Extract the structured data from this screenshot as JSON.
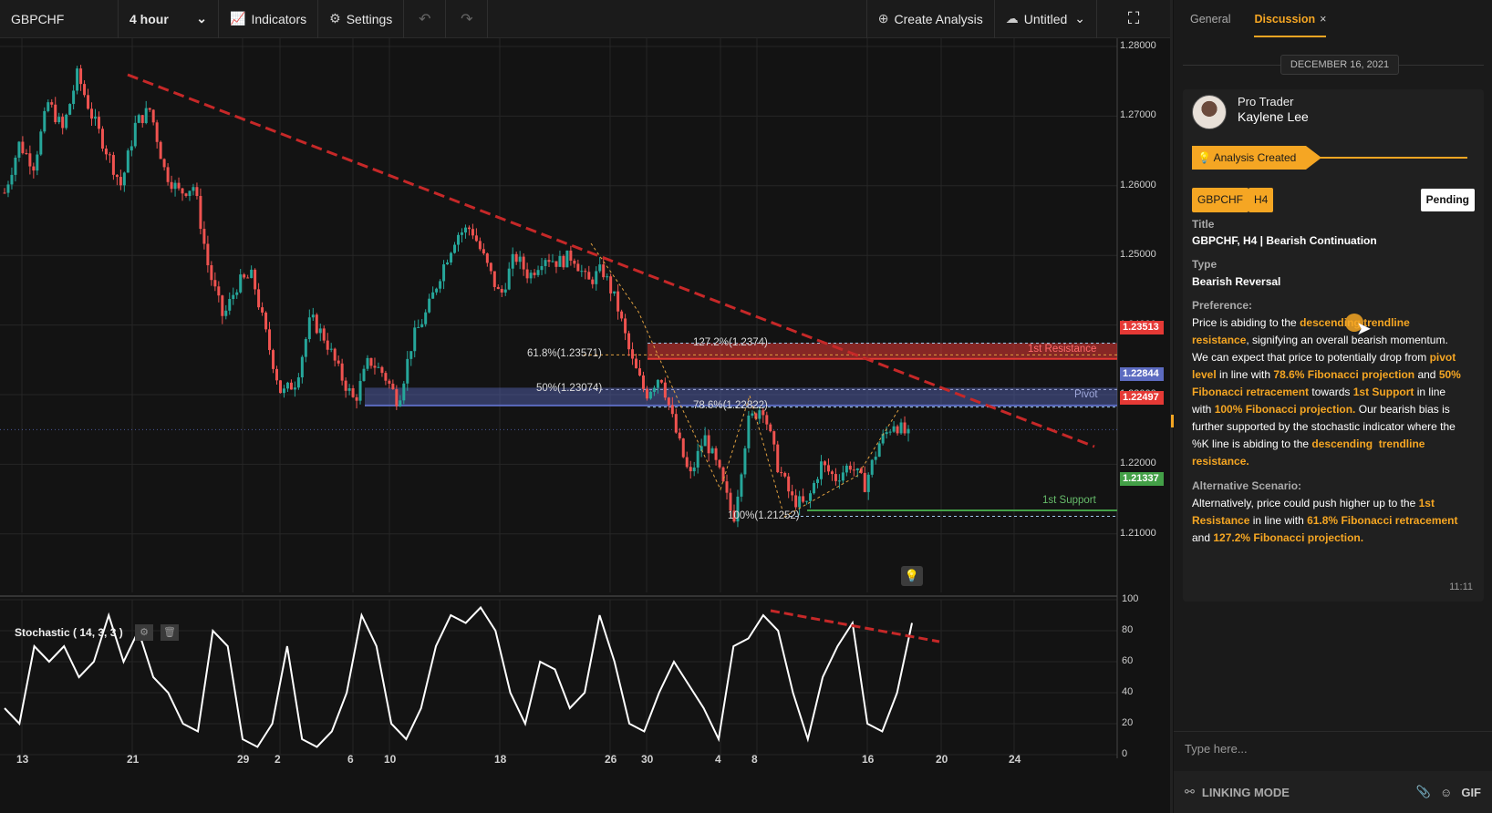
{
  "toolbar": {
    "symbol": "GBPCHF",
    "timeframe": "4 hour",
    "indicators_label": "Indicators",
    "settings_label": "Settings",
    "create_analysis_label": "Create Analysis",
    "save_label": "Untitled"
  },
  "chart_data": {
    "type": "candlestick",
    "symbol": "GBPCHF",
    "price_axis": [
      "1.28000",
      "1.27000",
      "1.26000",
      "1.25000",
      "1.24000",
      "1.23000",
      "1.22000",
      "1.21000"
    ],
    "x_labels": [
      "13",
      "21",
      "29",
      "2",
      "6",
      "10",
      "18",
      "26",
      "30",
      "4",
      "8",
      "16",
      "20",
      "24"
    ],
    "price_tags": [
      {
        "value": "1.23513",
        "color": "#e53935"
      },
      {
        "value": "1.22844",
        "color": "#5c6bc0"
      },
      {
        "value": "1.22497",
        "color": "#e53935"
      },
      {
        "value": "1.21337",
        "color": "#43a047"
      }
    ],
    "fib_labels": [
      {
        "text": "61.8%(1.23571)",
        "color": "#e0a040"
      },
      {
        "text": "50%(1.23074)",
        "color": "#9fa8da"
      },
      {
        "text": "127.2%(1.2374)",
        "color": "#9fc5e8"
      },
      {
        "text": "78.6%(1.22822)",
        "color": "#9fc5e8"
      },
      {
        "text": "100%(1.21252)",
        "color": "#9fc5e8"
      }
    ],
    "zones": {
      "resistance": "1st Resistance",
      "pivot": "Pivot",
      "support": "1st Support"
    },
    "price_path": [
      1.259,
      1.266,
      1.263,
      1.272,
      1.268,
      1.276,
      1.27,
      1.265,
      1.26,
      1.269,
      1.271,
      1.262,
      1.259,
      1.26,
      1.248,
      1.241,
      1.246,
      1.247,
      1.238,
      1.23,
      1.232,
      1.241,
      1.238,
      1.233,
      1.229,
      1.235,
      1.233,
      1.229,
      1.238,
      1.242,
      1.248,
      1.253,
      1.254,
      1.249,
      1.244,
      1.25,
      1.247,
      1.25,
      1.249,
      1.25,
      1.246,
      1.248,
      1.243,
      1.235,
      1.23,
      1.233,
      1.225,
      1.218,
      1.224,
      1.219,
      1.212,
      1.226,
      1.2285,
      1.22,
      1.215,
      1.214,
      1.22,
      1.218,
      1.22,
      1.217,
      1.223,
      1.226,
      1.224
    ],
    "stochastic": {
      "title": "Stochastic ( 14, 3, 3 )",
      "axis": [
        "100",
        "80",
        "60",
        "40",
        "20",
        "0"
      ],
      "values": [
        30,
        20,
        70,
        60,
        70,
        50,
        60,
        90,
        60,
        80,
        50,
        40,
        20,
        15,
        80,
        70,
        10,
        5,
        20,
        70,
        10,
        5,
        15,
        40,
        90,
        70,
        20,
        10,
        30,
        70,
        90,
        85,
        95,
        80,
        40,
        20,
        60,
        55,
        30,
        40,
        90,
        60,
        20,
        15,
        40,
        60,
        45,
        30,
        10,
        70,
        75,
        90,
        80,
        40,
        10,
        50,
        70,
        85,
        20,
        15,
        40,
        85
      ]
    }
  },
  "panel": {
    "tab_general": "General",
    "tab_discussion": "Discussion",
    "date": "DECEMBER 16, 2021",
    "author_role": "Pro Trader",
    "author_name": "Kaylene Lee",
    "created_label": "Analysis Created",
    "badge_symbol": "GBPCHF",
    "badge_tf": "H4",
    "status": "Pending",
    "title_label": "Title",
    "title_value": "GBPCHF, H4 | Bearish Continuation",
    "type_label": "Type",
    "type_value": "Bearish Reversal",
    "pref_label": "Preference:",
    "alt_label": "Alternative Scenario:",
    "time": "11:11",
    "input_placeholder": "Type here...",
    "linking_mode": "LINKING MODE",
    "gif_label": "GIF"
  },
  "colors": {
    "accent": "#f5a623",
    "bull": "#26a69a",
    "bear": "#ef5350"
  }
}
